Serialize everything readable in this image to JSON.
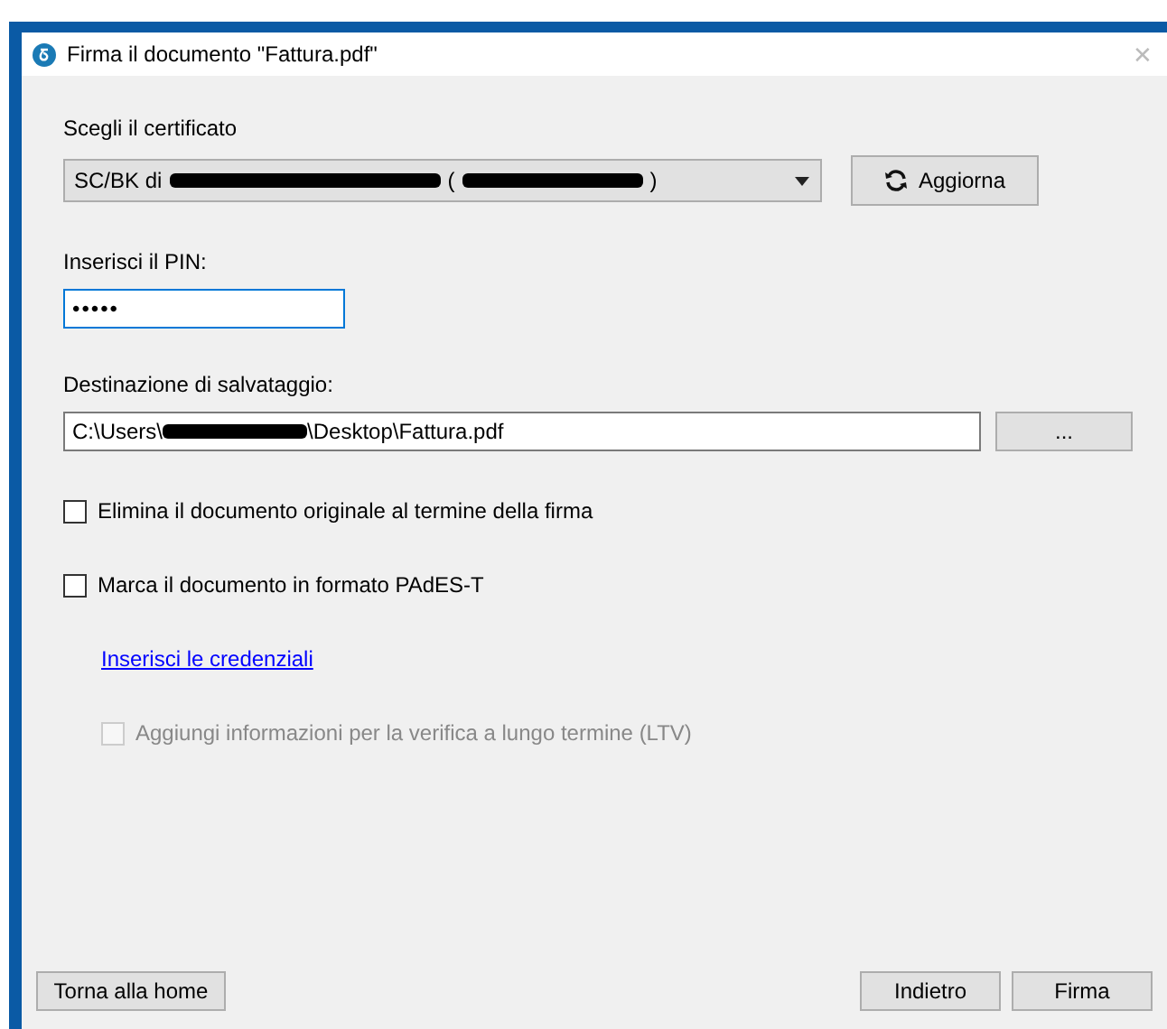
{
  "window": {
    "title": "Firma il documento \"Fattura.pdf\"",
    "close": "✕"
  },
  "certificate": {
    "label": "Scegli il certificato",
    "parts": [
      {
        "kind": "text",
        "text": "SC/BK di"
      },
      {
        "kind": "redacted"
      },
      {
        "kind": "text",
        "text": "("
      },
      {
        "kind": "redacted"
      },
      {
        "kind": "text",
        "text": ")"
      }
    ],
    "refresh_button": "Aggiorna"
  },
  "pin": {
    "label": "Inserisci il PIN:",
    "value": "•••••"
  },
  "destination": {
    "label": "Destinazione di salvataggio:",
    "parts": [
      {
        "kind": "text",
        "text": "C:\\Users\\"
      },
      {
        "kind": "redacted"
      },
      {
        "kind": "text",
        "text": "\\Desktop\\Fattura.pdf"
      }
    ],
    "browse_button": "..."
  },
  "options": [
    {
      "kind": "checkbox",
      "label": "Elimina il documento originale al termine della firma",
      "checked": false,
      "disabled": false
    },
    {
      "kind": "checkbox",
      "label": "Marca il documento in formato PAdES-T",
      "checked": false,
      "disabled": false
    },
    {
      "kind": "link",
      "label": "Inserisci le credenziali"
    },
    {
      "kind": "checkbox",
      "label": "Aggiungi informazioni per la verifica a lungo termine (LTV)",
      "checked": false,
      "disabled": true
    }
  ],
  "footer": {
    "left_buttons": [
      "Torna alla home"
    ],
    "right_buttons": [
      "Indietro",
      "Firma"
    ]
  }
}
